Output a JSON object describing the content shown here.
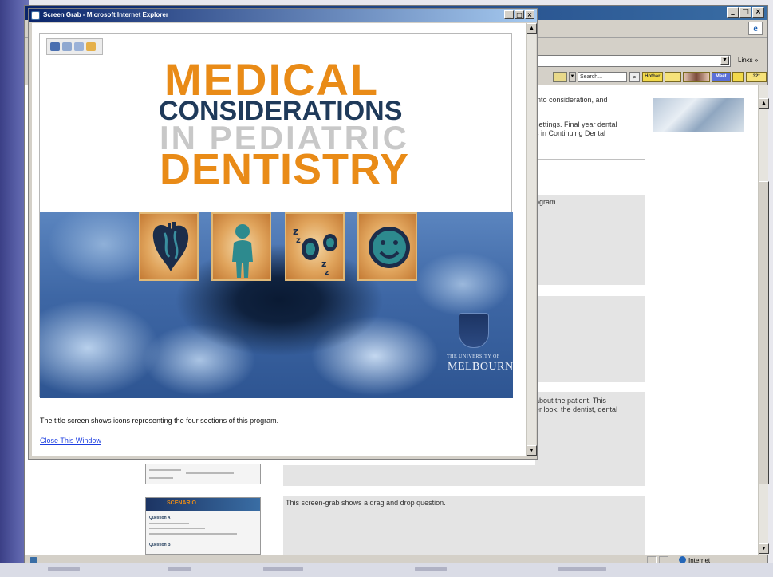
{
  "popup": {
    "title": "Screen Grab - Microsoft Internet Explorer",
    "controls": [
      "_",
      "□",
      "×"
    ],
    "hero": {
      "line1": "MEDICAL",
      "line2": "CONSIDERATIONS",
      "line3": "IN PEDIATRIC",
      "line4": "DENTISTRY"
    },
    "university": {
      "line1": "THE UNIVERSITY OF",
      "line2": "MELBOURNE"
    },
    "caption": "The title screen shows icons representing the four sections of this program.",
    "close_link": "Close This Window"
  },
  "browser": {
    "links_label": "Links »",
    "search_placeholder": "Search...",
    "hotbar_items": [
      "Hotbar",
      "",
      "",
      "Meet",
      "",
      "32°"
    ],
    "status_text": "Internet",
    "background_text": {
      "row1": "into consideration, and",
      "row2a": "settings. Final year dental",
      "row2b": "s in Continuing Dental",
      "row3": "ogram.",
      "row4a": "about the patient. This",
      "row4b": "er look, the dentist, dental",
      "row5": "This screen-grab shows a drag and drop question."
    },
    "thumb_labels": {
      "scenario": "SCENARIO",
      "question_a": "Question A",
      "question_b": "Question B"
    }
  },
  "colors": {
    "orange": "#e98b17",
    "navy": "#1f3a5a",
    "grey_text": "#c8c8c8",
    "link_blue": "#1c3ee0"
  }
}
